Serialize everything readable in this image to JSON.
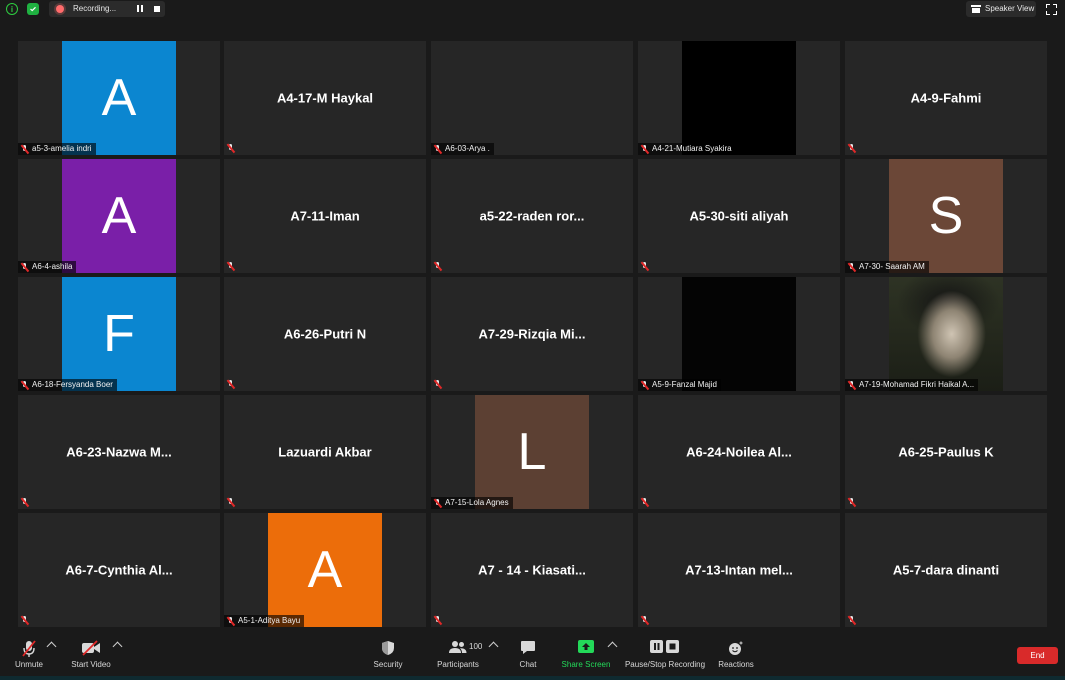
{
  "topbar": {
    "recording_label": "Recording...",
    "speaker_view_label": "Speaker View"
  },
  "tiles": [
    {
      "name": "a5-3-amelia indri",
      "avatar_letter": "A",
      "avatar_color": "#0b86d0"
    },
    {
      "name": "A4-17-M Haykal"
    },
    {
      "name": "A6-03-Arya ."
    },
    {
      "name": "A4-21-Mutiara Syakira"
    },
    {
      "name": "A4-9-Fahmi"
    },
    {
      "name": "A6-4-ashila",
      "avatar_letter": "A",
      "avatar_color": "#7a1fa8"
    },
    {
      "name": "A7-11-Iman"
    },
    {
      "name": "a5-22-raden ror..."
    },
    {
      "name": "A5-30-siti aliyah"
    },
    {
      "name": "A7-30- Saarah AM",
      "avatar_letter": "S",
      "avatar_color": "#6b4737"
    },
    {
      "name": "A6-18-Fersyanda Boer",
      "avatar_letter": "F",
      "avatar_color": "#0b86d0"
    },
    {
      "name": "A6-26-Putri N"
    },
    {
      "name": "A7-29-Rizqia  Mi..."
    },
    {
      "name": "A5-9-Fanzal Majid"
    },
    {
      "name": "A7-19-Mohamad Fikri Haikal A..."
    },
    {
      "name": "A6-23-Nazwa  M..."
    },
    {
      "name": "Lazuardi Akbar"
    },
    {
      "name": "A7-15-Lola Agnes",
      "avatar_letter": "L",
      "avatar_color": "#5c4033"
    },
    {
      "name": "A6-24-Noilea  Al..."
    },
    {
      "name": "A6-25-Paulus K"
    },
    {
      "name": "A6-7-Cynthia  Al..."
    },
    {
      "name": "A5-1-Aditya Bayu",
      "avatar_letter": "A",
      "avatar_color": "#ec6d0a"
    },
    {
      "name": "A7 - 14 - Kiasati..."
    },
    {
      "name": "A7-13-Intan  mel..."
    },
    {
      "name": "A5-7-dara dinanti"
    }
  ],
  "toolbar": {
    "unmute_label": "Unmute",
    "start_video_label": "Start Video",
    "security_label": "Security",
    "participants_label": "Participants",
    "participants_count": "100",
    "chat_label": "Chat",
    "share_screen_label": "Share Screen",
    "share_screen_color": "#23d959",
    "pause_recording_label": "Pause/Stop Recording",
    "reactions_label": "Reactions",
    "end_label": "End",
    "end_color": "#d92a2a"
  }
}
